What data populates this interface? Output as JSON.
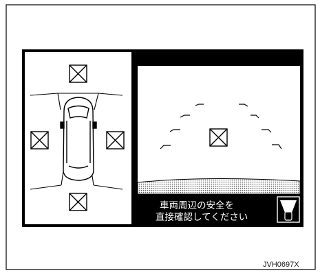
{
  "display": {
    "warning_line_1": "車両周辺の安全を",
    "warning_line_2": "直接確認してください"
  },
  "figure_code": "JVH0697X",
  "icons": {
    "camera_placeholder": "crossed-box-icon",
    "overhead_car": "car-top-view-icon",
    "front_view_indicator": "front-view-mode-icon"
  },
  "colors": {
    "screen_background": "#000000",
    "frame_line": "#000000",
    "page_background": "#ffffff"
  }
}
